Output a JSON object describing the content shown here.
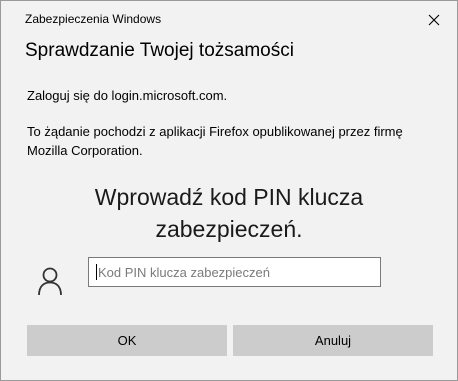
{
  "window": {
    "title": "Zabezpieczenia Windows",
    "close_icon": "close-icon"
  },
  "content": {
    "heading": "Sprawdzanie Twojej tożsamości",
    "signin_text": "Zaloguj się do login.microsoft.com.",
    "request_text": "To żądanie pochodzi z aplikacji Firefox opublikowanej przez firmę Mozilla Corporation.",
    "prompt": "Wprowadź kod PIN klucza zabezpieczeń.",
    "user_icon": "user-icon"
  },
  "pin": {
    "placeholder": "Kod PIN klucza zabezpieczeń",
    "value": ""
  },
  "buttons": {
    "ok_label": "OK",
    "cancel_label": "Anuluj"
  },
  "colors": {
    "dialog_background": "#f2f2f2",
    "button_background": "#cccccc",
    "input_border": "#7a7a7a"
  }
}
